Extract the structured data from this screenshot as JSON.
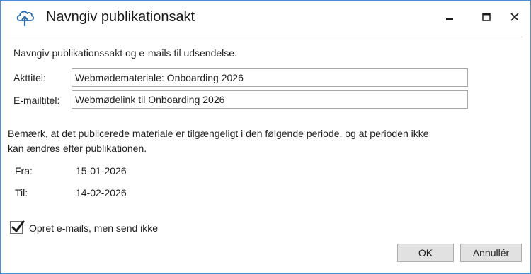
{
  "window": {
    "title": "Navngiv publikationsakt",
    "icon": "cloud-upload-icon",
    "controls": {
      "minimize": "minimize-icon",
      "maximize": "maximize-icon",
      "close": "close-icon"
    }
  },
  "form": {
    "intro": "Navngiv publikationssakt og e-mails til udsendelse.",
    "akt_title_label": "Akttitel:",
    "akt_title_value": "Webmødemateriale: Onboarding 2026",
    "email_title_label": "E-mailtitel:",
    "email_title_value": "Webmødelink til Onboarding 2026",
    "note_line1": "Bemærk, at det publicerede materiale er tilgængeligt i den følgende periode, og at perioden ikke",
    "note_line2": "kan ændres efter publikationen.",
    "from_label": "Fra:",
    "from_value": "15-01-2026",
    "to_label": "Til:",
    "to_value": "14-02-2026",
    "checkbox_label": "Opret e-mails, men send ikke",
    "checkbox_checked": true
  },
  "buttons": {
    "ok": "OK",
    "cancel": "Annullér"
  },
  "colors": {
    "accent": "#4a90d9",
    "icon_blue": "#2b6cb0"
  }
}
